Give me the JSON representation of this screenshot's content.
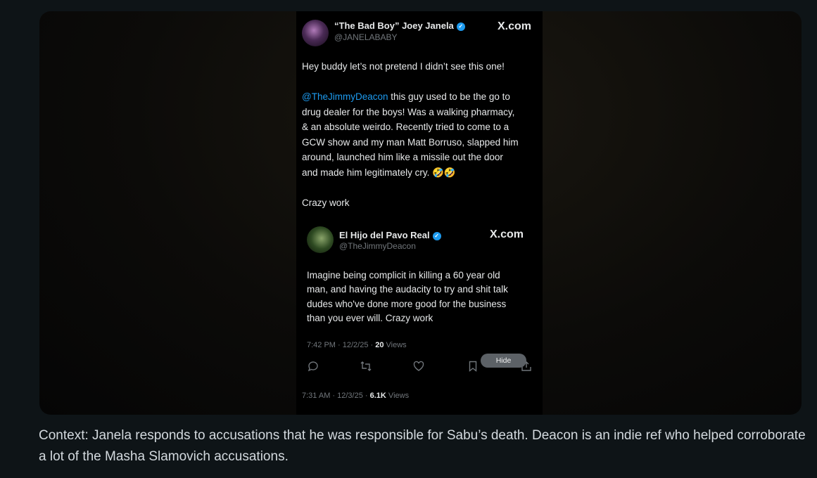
{
  "outer_tweet": {
    "display_name": "“The Bad Boy” Joey Janela",
    "handle": "@JANELABABY",
    "brand": "X.com",
    "line1": "Hey buddy let’s not pretend I didn’t see this one!",
    "mention": "@TheJimmyDeacon",
    "mention_rest": " this guy used to be the go to",
    "lines": [
      "drug dealer for the boys! Was a walking pharmacy,",
      "& an absolute weirdo. Recently tried to come to a",
      "GCW show and my man Matt Borruso, slapped him",
      "around, launched him like a missile out the door",
      "and made him legitimately cry. 🤣🤣"
    ],
    "closing": "Crazy work",
    "time": "7:31 AM · 12/3/25 · ",
    "views_count": "6.1K",
    "views_label": " Views"
  },
  "quoted_tweet": {
    "display_name": "El Hijo del Pavo Real",
    "handle": "@TheJimmyDeacon",
    "brand": "X.com",
    "lines": [
      "Imagine being complicit in killing a 60 year old",
      "man, and having the audacity to try and shit talk",
      "dudes who've done more good for the business",
      "than you ever will. Crazy work"
    ],
    "time": "7:42 PM · 12/2/25 · ",
    "views_count": "20",
    "views_label": " Views",
    "actions": [
      "reply-icon",
      "retweet-icon",
      "like-icon",
      "bookmark-icon",
      "share-icon"
    ]
  },
  "hide_button": "Hide",
  "verified_glyph": "✓",
  "context": "Context: Janela responds to accusations that he was responsible for Sabu’s death. Deacon is an indie ref who helped corroborate a lot of the Masha Slamovich accusations.",
  "colors": {
    "background": "#0e1417",
    "mention": "#1d9bf0",
    "verified": "#1d9bf0",
    "muted": "#71767b"
  }
}
